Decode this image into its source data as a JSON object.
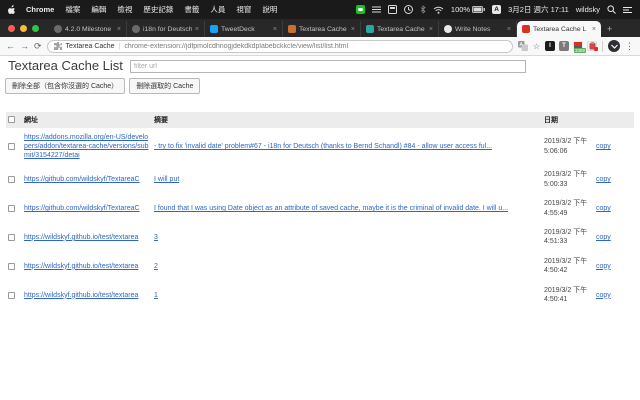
{
  "colors": {
    "traffic_red": "#ff5f57",
    "traffic_yellow": "#febc2e",
    "traffic_green": "#28c840",
    "link_blue": "#2f66c2",
    "line_green": "#14c321",
    "twitter_blue": "#1da1f2",
    "active_fav_red": "#d93025",
    "teal_fav": "#2aa8a0",
    "store_fav_orange": "#c9702e",
    "badge_green": "#5fae62"
  },
  "glyphs": {
    "close": "×",
    "plus": "+",
    "back": "←",
    "forward": "→",
    "reload": "⟳",
    "star": "☆",
    "kebab": "⋮"
  },
  "menubar": {
    "items": [
      "Chrome",
      "檔案",
      "編輯",
      "檢視",
      "歷史記錄",
      "書籤",
      "人員",
      "視窗",
      "說明"
    ],
    "status": {
      "battery": "100%",
      "ime": "A",
      "datetime": "3月2日 週六 17:11",
      "user": "wildsky"
    }
  },
  "tabs": [
    {
      "label": "4.2.0 Milestone"
    },
    {
      "label": "i18n for Deutsch"
    },
    {
      "label": "TweetDeck"
    },
    {
      "label": "Textarea Cache"
    },
    {
      "label": "Textarea Cache"
    },
    {
      "label": "Write Notes"
    },
    {
      "label": "Textarea Cache L"
    }
  ],
  "toolbar": {
    "site_name": "Textarea Cache",
    "url": "chrome-extension://jdfpmolcdhnogjdekdkdplabebckkcle/view/list/list.html",
    "ext1_label": "I",
    "ext2_label": "T",
    "ext3_badge": "3389"
  },
  "page": {
    "title": "Textarea Cache List",
    "filter_placeholder": "filter url",
    "buttons": {
      "delete_all": "刪除全部（包含你沒選的 Cache）",
      "delete_selected": "刪除選取的 Cache"
    },
    "table": {
      "headers": {
        "url": "網址",
        "summary": "摘要",
        "date": "日期"
      },
      "copy_label": "copy",
      "rows": [
        {
          "url": "https://addons.mozilla.org/en-US/developers/addon/textarea-cache/versions/submit/3154227/detai",
          "summary": "- try to fix 'invalid date' problem#67 - i18n for Deutsch (thanks to Bernd Schandl) #84 - allow user access ful...",
          "date": "2019/3/2 下午",
          "time": "5:06:06"
        },
        {
          "url": "https://github.com/wildskyf/TextareaC",
          "summary": "I will put",
          "date": "2019/3/2 下午",
          "time": "5:00:33"
        },
        {
          "url": "https://github.com/wildskyf/TextareaC",
          "summary": "I found that I was using Date object as an attribute of saved cache, maybe it is the criminal of invalid date. I will u...",
          "date": "2019/3/2 下午",
          "time": "4:55:49"
        },
        {
          "url": "https://wildskyf.github.io/test/textarea",
          "summary": "3",
          "date": "2019/3/2 下午",
          "time": "4:51:33"
        },
        {
          "url": "https://wildskyf.github.io/test/textarea",
          "summary": "2",
          "date": "2019/3/2 下午",
          "time": "4:50:42"
        },
        {
          "url": "https://wildskyf.github.io/test/textarea",
          "summary": "1",
          "date": "2019/3/2 下午",
          "time": "4:50:41"
        }
      ]
    }
  }
}
